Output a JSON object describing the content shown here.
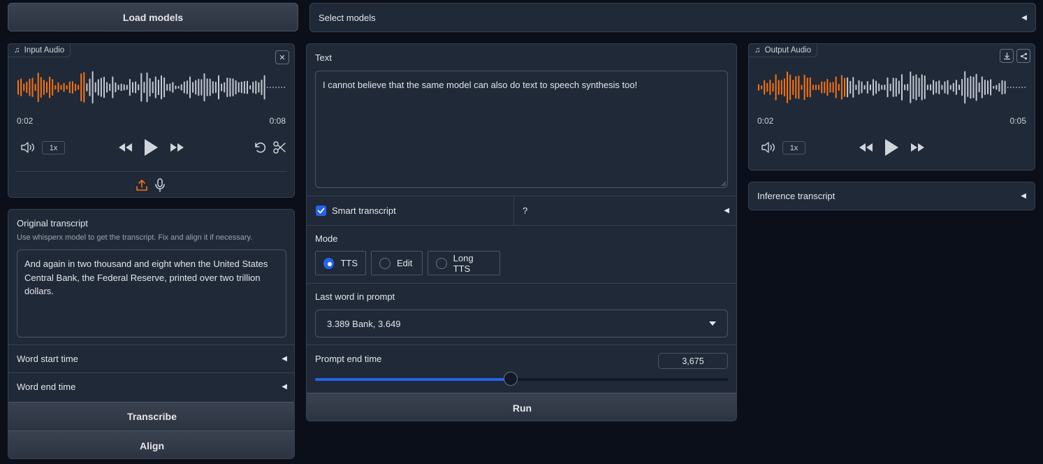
{
  "top": {
    "load_models_label": "Load models",
    "select_models_label": "Select models"
  },
  "input_audio": {
    "label": "Input Audio",
    "current_time": "0:02",
    "duration": "0:08",
    "speed": "1x",
    "progress": 0.25
  },
  "original_transcript": {
    "label": "Original transcript",
    "info": "Use whisperx model to get the transcript. Fix and align it if necessary.",
    "value": "And again in two thousand and eight when the United States Central Bank, the Federal Reserve, printed over two trillion dollars."
  },
  "left_accordions": {
    "word_start_label": "Word start time",
    "word_end_label": "Word end time"
  },
  "left_buttons": {
    "transcribe_label": "Transcribe",
    "align_label": "Align"
  },
  "center": {
    "text_label": "Text",
    "text_value": "I cannot believe that the same model can also do text to speech synthesis too!",
    "smart_transcript_label": "Smart transcript",
    "smart_transcript_checked": true,
    "help_accordion_label": "?",
    "mode_label": "Mode",
    "mode_options": [
      "TTS",
      "Edit",
      "Long TTS"
    ],
    "mode_selected": "TTS",
    "last_word_label": "Last word in prompt",
    "last_word_value": "3.389 Bank, 3.649",
    "prompt_end_label": "Prompt end time",
    "prompt_end_value": "3,675",
    "slider_fraction": 0.4745,
    "run_label": "Run"
  },
  "output_audio": {
    "label": "Output Audio",
    "current_time": "0:02",
    "duration": "0:05",
    "speed": "1x",
    "progress": 0.32
  },
  "inference_transcript": {
    "label": "Inference transcript"
  },
  "colors": {
    "background": "#0b0f19",
    "panel": "#1f2937",
    "border": "#374151",
    "waveform_played": "#f97316",
    "waveform_unplayed": "#9ca3af",
    "accent": "#2563eb"
  }
}
